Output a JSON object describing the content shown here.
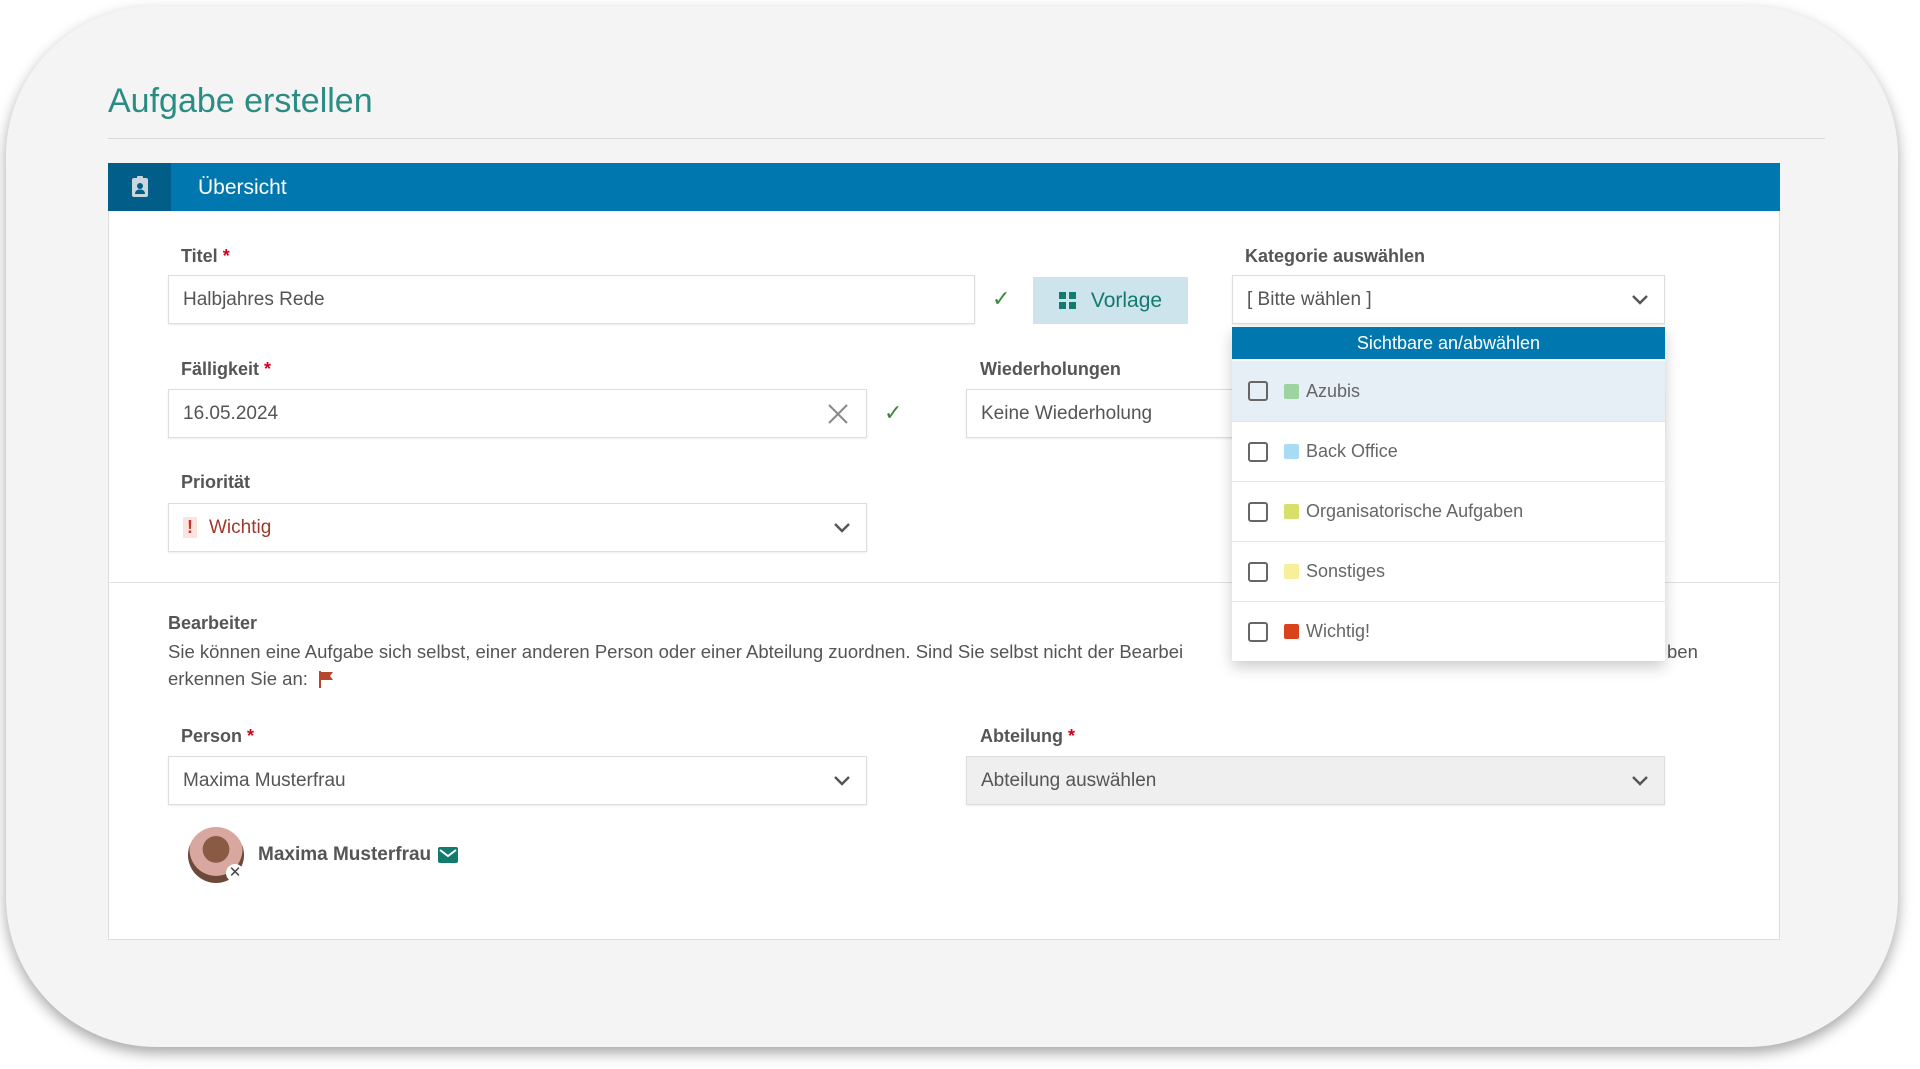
{
  "page_title": "Aufgabe erstellen",
  "section": {
    "title": "Übersicht",
    "icon": "badge-icon"
  },
  "fields": {
    "titel": {
      "label": "Titel",
      "required": "*",
      "value": "Halbjahres Rede"
    },
    "vorlage_button": "Vorlage",
    "kategorie": {
      "label": "Kategorie auswählen",
      "value": "[ Bitte wählen ]"
    },
    "faelligkeit": {
      "label": "Fälligkeit",
      "required": "*",
      "value": "16.05.2024"
    },
    "wiederholungen": {
      "label": "Wiederholungen",
      "value": "Keine Wiederholung"
    },
    "prioritaet": {
      "label": "Priorität",
      "value": "Wichtig",
      "color": "#c0392b"
    }
  },
  "dropdown": {
    "toggle_label": "Sichtbare an/abwählen",
    "items": [
      {
        "label": "Azubis",
        "color": "#9dd3a0",
        "checked": false,
        "highlighted": true
      },
      {
        "label": "Back Office",
        "color": "#a8dcf5",
        "checked": false
      },
      {
        "label": "Organisatorische Aufgaben",
        "color": "#d6e06a",
        "checked": false
      },
      {
        "label": "Sonstiges",
        "color": "#f7ef9a",
        "checked": false
      },
      {
        "label": "Wichtig!",
        "color": "#d9421b",
        "checked": false
      }
    ]
  },
  "bearbeiter": {
    "title": "Bearbeiter",
    "text_line1": "Sie können eine Aufgabe sich selbst, einer anderen Person oder einer Abteilung zuordnen. Sind Sie selbst nicht der Bearbei",
    "text_line1_end": "ben",
    "text_line2": "erkennen Sie an:",
    "person": {
      "label": "Person",
      "required": "*",
      "value": "Maxima Musterfrau"
    },
    "abteilung": {
      "label": "Abteilung",
      "required": "*",
      "value": "Abteilung auswählen"
    },
    "assigned": {
      "name": "Maxima Musterfrau"
    }
  },
  "colors": {
    "header": "#0077ae",
    "title": "#2a8c82",
    "accent": "#137a6e"
  }
}
